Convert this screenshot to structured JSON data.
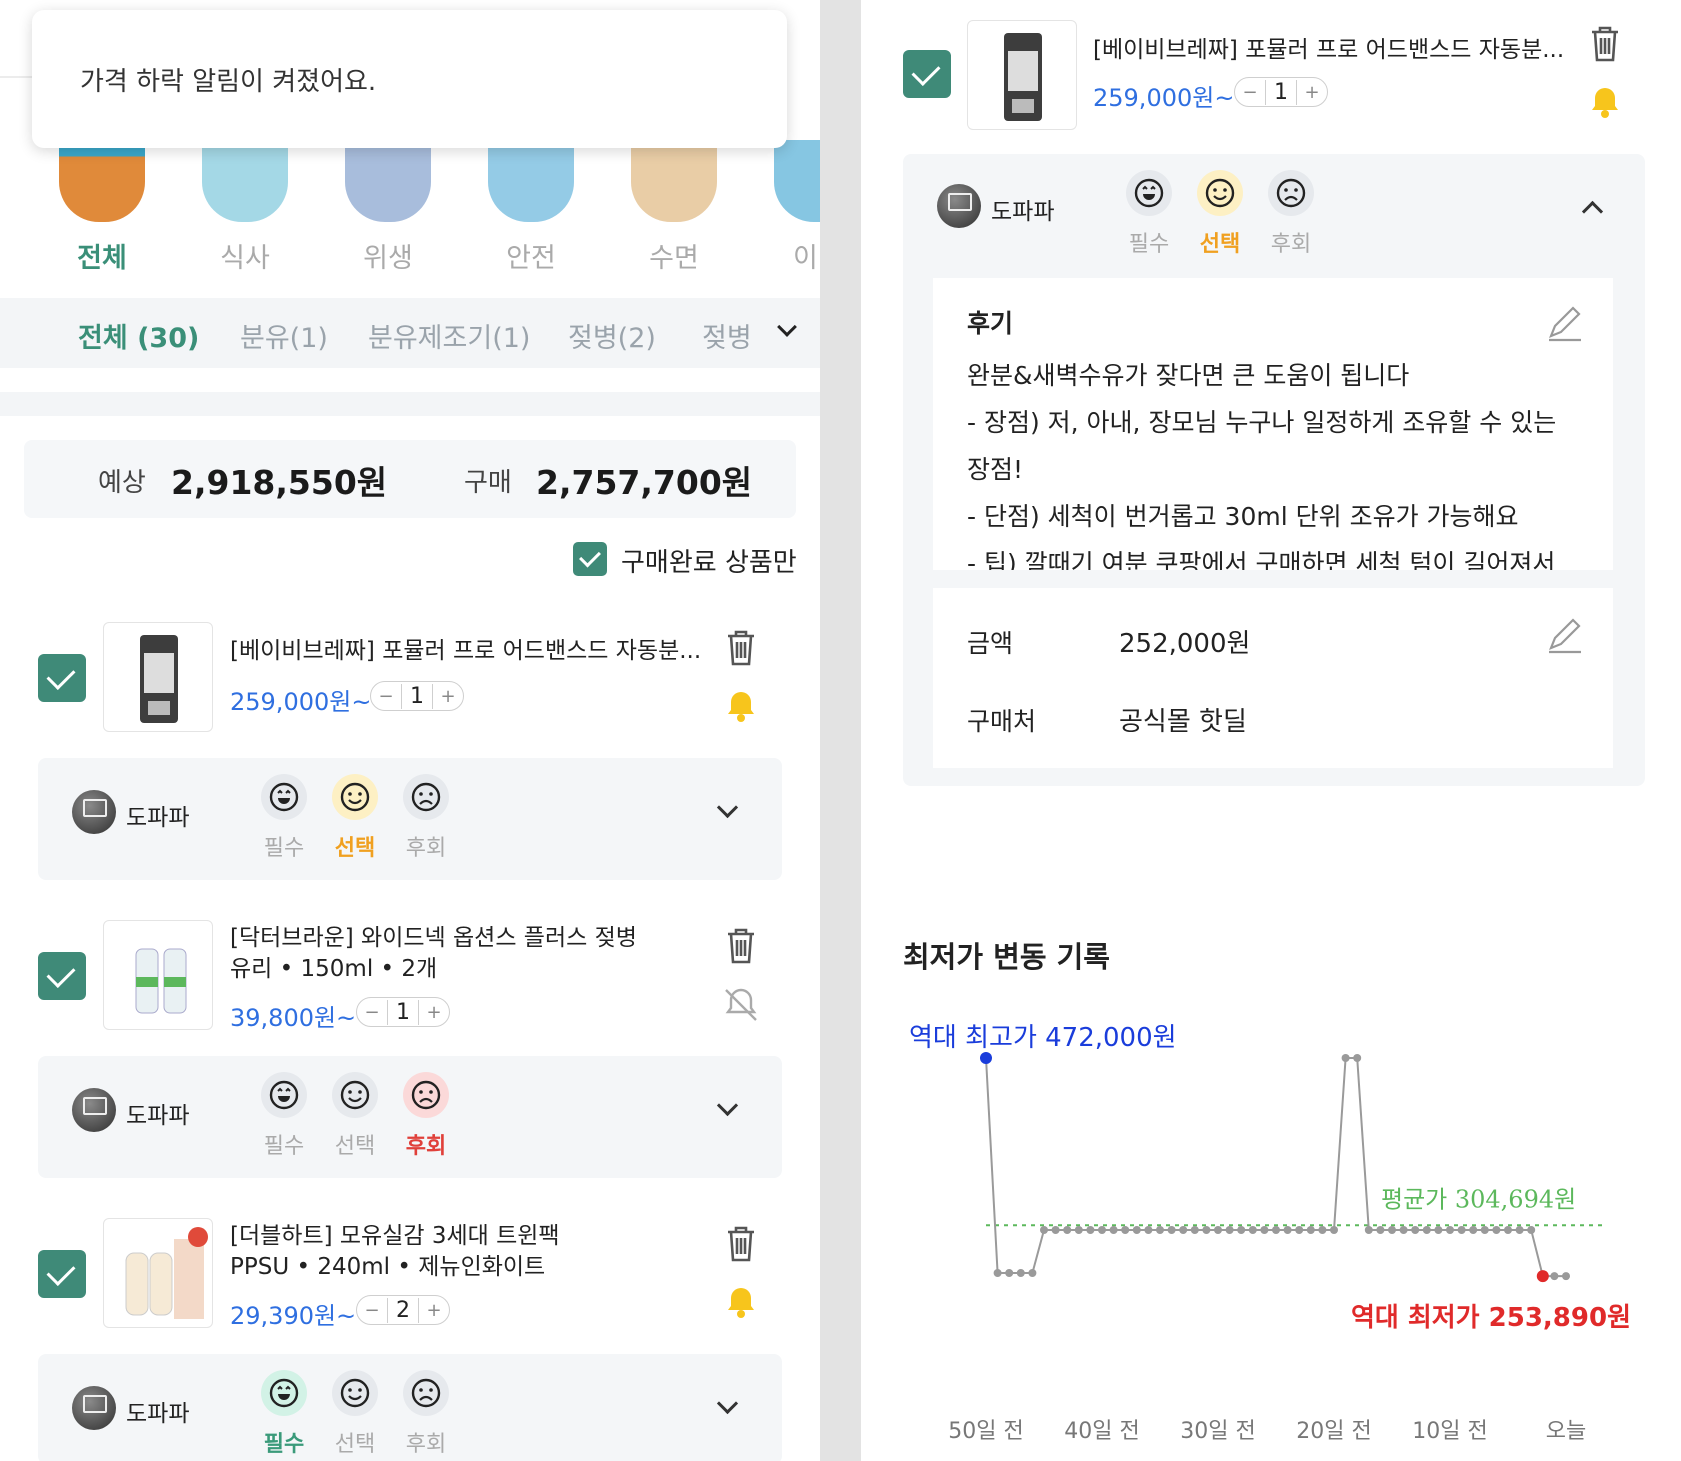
{
  "toast": {
    "message": "가격 하락 알림이 켜졌어요."
  },
  "categories": [
    {
      "label": "전체",
      "color": "#e9a15a",
      "active": true
    },
    {
      "label": "식사",
      "color": "#9fd6e6",
      "active": false
    },
    {
      "label": "위생",
      "color": "#9cb7d8",
      "active": false
    },
    {
      "label": "안전",
      "color": "#8ec8e8",
      "active": false
    },
    {
      "label": "수면",
      "color": "#e8c99e",
      "active": false
    },
    {
      "label": "이",
      "color": "#7fc3e0",
      "active": false
    }
  ],
  "subtabs": [
    {
      "label": "전체 (30)",
      "active": true
    },
    {
      "label": "분유(1)",
      "active": false
    },
    {
      "label": "분유제조기(1)",
      "active": false
    },
    {
      "label": "젖병(2)",
      "active": false
    },
    {
      "label": "젖병",
      "active": false
    }
  ],
  "summary": {
    "expected_label": "예상",
    "expected_value": "2,918,550원",
    "bought_label": "구매",
    "bought_value": "2,757,700원"
  },
  "filter": {
    "only_purchased_label": "구매완료 상품만",
    "checked": true
  },
  "products": [
    {
      "title_line1": "[베이비브레짜] 포뮬러 프로 어드밴스드 자동분...",
      "title_line2": "",
      "price": "259,000원~",
      "qty": "1",
      "alarm": "on",
      "reviewer": "도파파",
      "rating": "선택"
    },
    {
      "title_line1": "[닥터브라운] 와이드넥 옵션스 플러스 젖병",
      "title_line2": "유리 • 150ml • 2개",
      "price": "39,800원~",
      "qty": "1",
      "alarm": "off",
      "reviewer": "도파파",
      "rating": "후회"
    },
    {
      "title_line1": "[더블하트] 모유실감 3세대 트윈팩",
      "title_line2": "PPSU • 240ml • 제뉴인화이트",
      "price": "29,390원~",
      "qty": "2",
      "alarm": "on",
      "reviewer": "도파파",
      "rating": "필수"
    }
  ],
  "rating_labels": {
    "must": "필수",
    "choice": "선택",
    "regret": "후회"
  },
  "detail": {
    "product": {
      "title": "[베이비브레짜] 포뮬러 프로 어드밴스드 자동분...",
      "price": "259,000원~",
      "qty": "1"
    },
    "reviewer": "도파파",
    "review_label": "후기",
    "review_lines": [
      "완분&새벽수유가 잦다면 큰 도움이 됩니다",
      "- 장점) 저, 아내, 장모님 누구나 일정하게 조유할 수 있는",
      "장점!",
      "- 단점) 세척이 번거롭고 30ml 단위 조유가 가능해요",
      "- 팁) 깔때기 여분 쿠팡에서 구매하면 세척 텀이 길어져서"
    ],
    "amount_label": "금액",
    "amount_value": "252,000원",
    "store_label": "구매처",
    "store_value": "공식몰 핫딜"
  },
  "history": {
    "title": "최저가 변동 기록"
  },
  "chart_data": {
    "type": "line",
    "x_tick_labels": [
      "50일 전",
      "40일 전",
      "30일 전",
      "20일 전",
      "10일 전",
      "오늘"
    ],
    "x_days_ago": [
      50,
      49,
      48,
      47,
      46,
      45,
      44,
      43,
      42,
      41,
      40,
      39,
      38,
      37,
      36,
      35,
      34,
      33,
      32,
      31,
      30,
      29,
      28,
      27,
      26,
      25,
      24,
      23,
      22,
      21,
      20,
      19,
      18,
      17,
      16,
      15,
      14,
      13,
      12,
      11,
      10,
      9,
      8,
      7,
      6,
      5,
      4,
      3,
      2,
      1,
      0
    ],
    "values": [
      472000,
      257000,
      257000,
      257000,
      257000,
      300000,
      300000,
      300000,
      300000,
      300000,
      300000,
      300000,
      300000,
      300000,
      300000,
      300000,
      300000,
      300000,
      300000,
      300000,
      300000,
      300000,
      300000,
      300000,
      300000,
      300000,
      300000,
      300000,
      300000,
      300000,
      300000,
      472000,
      472000,
      300000,
      300000,
      300000,
      300000,
      300000,
      300000,
      300000,
      300000,
      300000,
      300000,
      300000,
      300000,
      300000,
      300000,
      300000,
      253890,
      253890,
      253890
    ],
    "average": 304694,
    "ylim": [
      240000,
      480000
    ],
    "annotations": {
      "max_label": "역대 최고가 472,000원",
      "min_label": "역대 최저가 253,890원",
      "avg_label": "평균가 304,694원"
    },
    "colors": {
      "line": "#9a9a9a",
      "max": "#1a3ddb",
      "min": "#e02a2a",
      "avg": "#5cb85c"
    }
  }
}
